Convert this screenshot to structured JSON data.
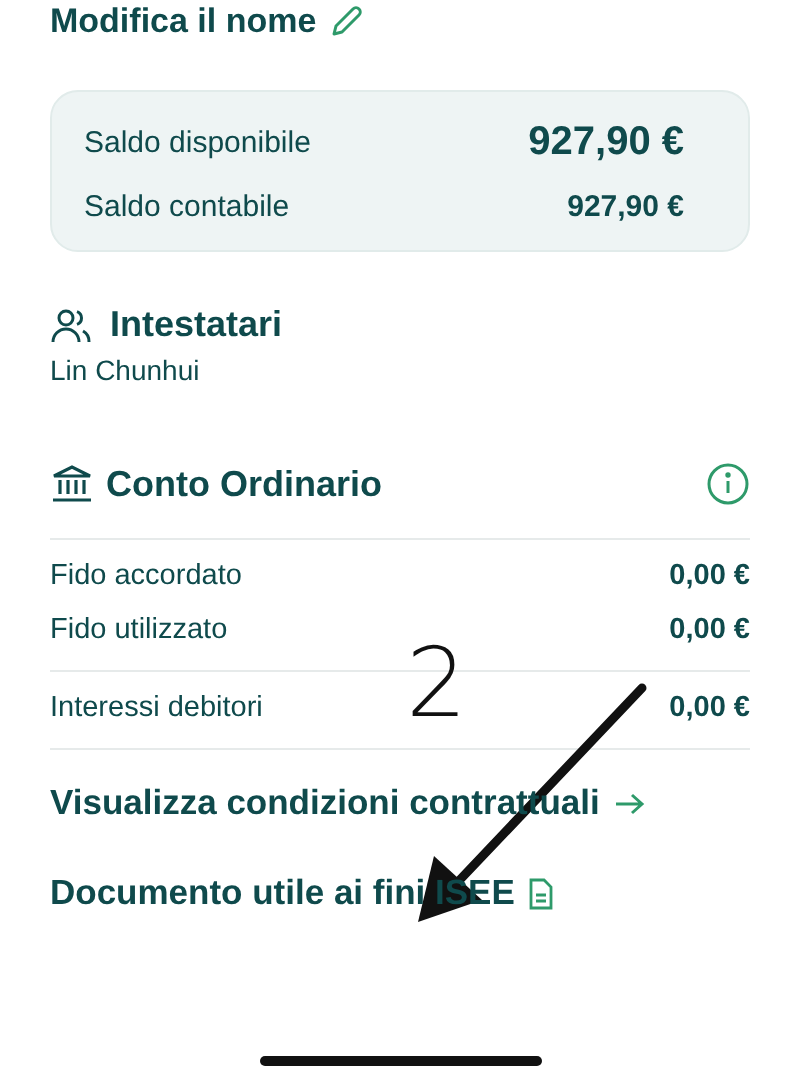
{
  "header": {
    "title": "Modifica il nome"
  },
  "balances": [
    {
      "label": "Saldo disponibile",
      "value": "927,90 €",
      "kind": "primary"
    },
    {
      "label": "Saldo contabile",
      "value": "927,90 €",
      "kind": "secondary"
    }
  ],
  "holders": {
    "title": "Intestatari",
    "names": [
      "Lin Chunhui"
    ]
  },
  "account": {
    "title": "Conto Ordinario",
    "groups": [
      [
        {
          "label": "Fido accordato",
          "value": "0,00 €"
        },
        {
          "label": "Fido utilizzato",
          "value": "0,00 €"
        }
      ],
      [
        {
          "label": "Interessi debitori",
          "value": "0,00 €"
        }
      ]
    ]
  },
  "links": [
    {
      "label": "Visualizza condizioni contrattuali",
      "kind": "arrow"
    },
    {
      "label": "Documento utile ai fini ISEE",
      "kind": "document"
    }
  ],
  "annotation": {
    "label": "2"
  }
}
